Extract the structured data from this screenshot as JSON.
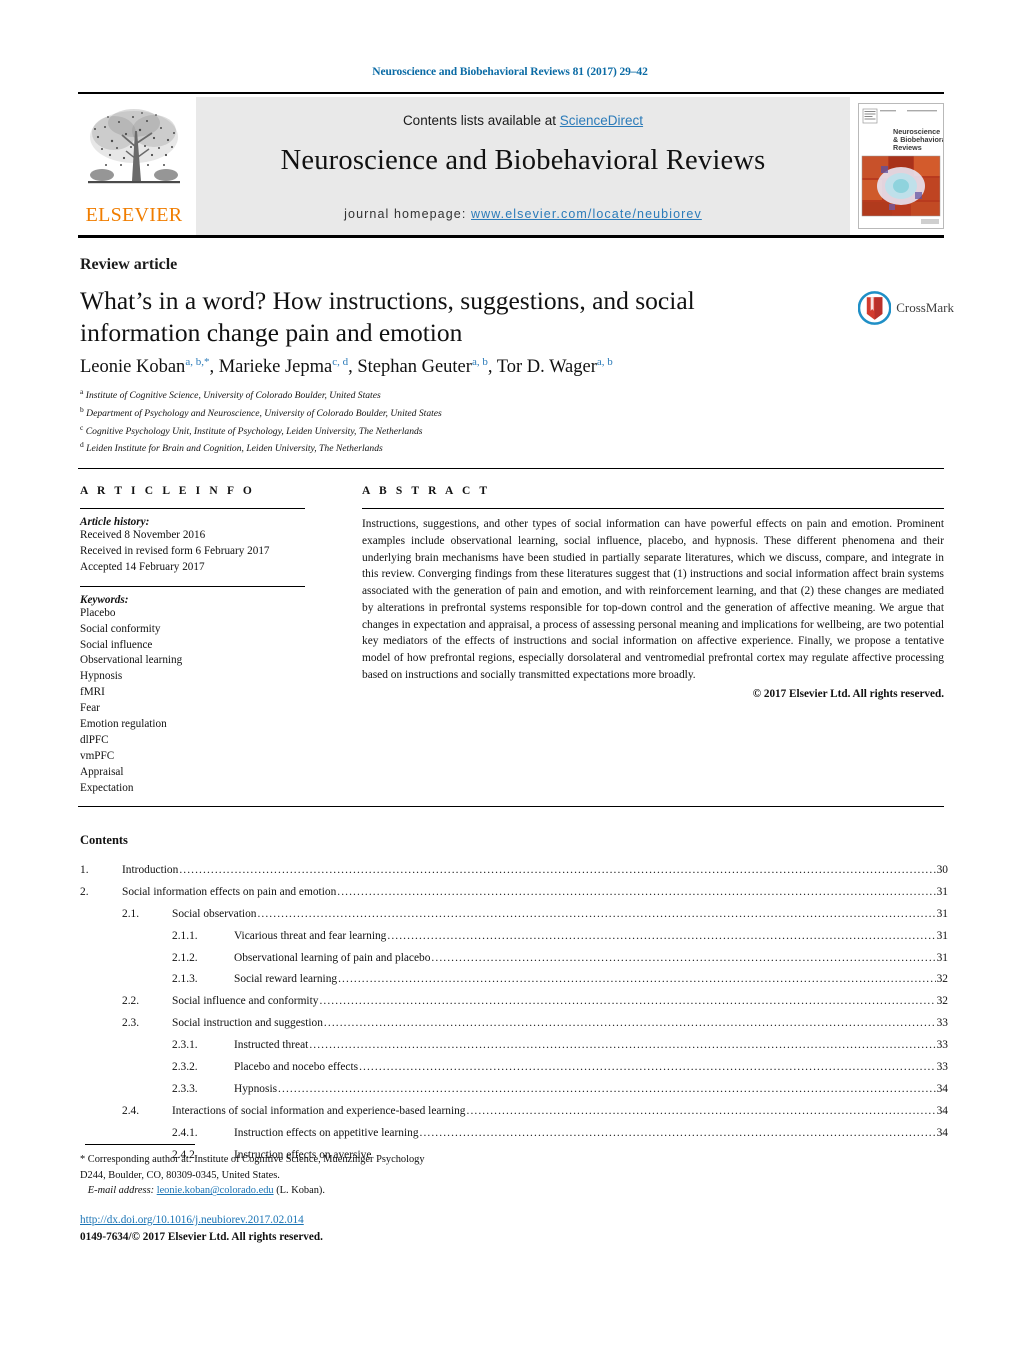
{
  "running_head": "Neuroscience and Biobehavioral Reviews 81 (2017) 29–42",
  "masthead": {
    "contents_prefix": "Contents lists available at ",
    "sciencedirect": "ScienceDirect",
    "journal_title": "Neuroscience and Biobehavioral Reviews",
    "homepage_label": "journal homepage:",
    "homepage_url": "www.elsevier.com/locate/neubiorev",
    "publisher_wordmark": "ELSEVIER",
    "cover_title_line1": "Neuroscience",
    "cover_title_line2": "& Biobehavioral",
    "cover_title_line3": "Reviews"
  },
  "article": {
    "type_label": "Review article",
    "title": "What’s in a word? How instructions, suggestions, and social information change pain and emotion",
    "crossmark_label": "CrossMark",
    "authors": [
      {
        "name": "Leonie Koban",
        "sup": "a, b,",
        "star": "*"
      },
      {
        "name": "Marieke Jepma",
        "sup": "c, d"
      },
      {
        "name": "Stephan Geuter",
        "sup": "a, b"
      },
      {
        "name": "Tor D. Wager",
        "sup": "a, b"
      }
    ],
    "affiliations": [
      {
        "marker": "a",
        "text": "Institute of Cognitive Science, University of Colorado Boulder, United States"
      },
      {
        "marker": "b",
        "text": "Department of Psychology and Neuroscience, University of Colorado Boulder, United States"
      },
      {
        "marker": "c",
        "text": "Cognitive Psychology Unit, Institute of Psychology, Leiden University, The Netherlands"
      },
      {
        "marker": "d",
        "text": "Leiden Institute for Brain and Cognition, Leiden University, The Netherlands"
      }
    ]
  },
  "article_info": {
    "heading": "A R T I C L E   I N F O",
    "history_heading": "Article history:",
    "history": [
      "Received 8 November 2016",
      "Received in revised form 6 February 2017",
      "Accepted 14 February 2017"
    ],
    "keywords_heading": "Keywords:",
    "keywords": [
      "Placebo",
      "Social conformity",
      "Social influence",
      "Observational learning",
      "Hypnosis",
      "fMRI",
      "Fear",
      "Emotion regulation",
      "dlPFC",
      "vmPFC",
      "Appraisal",
      "Expectation"
    ]
  },
  "abstract": {
    "heading": "A B S T R A C T",
    "text": "Instructions, suggestions, and other types of social information can have powerful effects on pain and emotion. Prominent examples include observational learning, social influence, placebo, and hypnosis. These different phenomena and their underlying brain mechanisms have been studied in partially separate literatures, which we discuss, compare, and integrate in this review. Converging findings from these literatures suggest that (1) instructions and social information affect brain systems associated with the generation of pain and emotion, and with reinforcement learning, and that (2) these changes are mediated by alterations in prefrontal systems responsible for top-down control and the generation of affective meaning. We argue that changes in expectation and appraisal, a process of assessing personal meaning and implications for wellbeing, are two potential key mediators of the effects of instructions and social information on affective experience. Finally, we propose a tentative model of how prefrontal regions, especially dorsolateral and ventromedial prefrontal cortex may regulate affective processing based on instructions and socially transmitted expectations more broadly.",
    "copyright": "© 2017 Elsevier Ltd. All rights reserved."
  },
  "contents": {
    "heading": "Contents",
    "entries": [
      {
        "level": 1,
        "num": "1.",
        "label": "Introduction",
        "page": "30"
      },
      {
        "level": 1,
        "num": "2.",
        "label": "Social information effects on pain and emotion",
        "page": "31"
      },
      {
        "level": 2,
        "num": "2.1.",
        "label": "Social observation",
        "page": "31"
      },
      {
        "level": 3,
        "num": "2.1.1.",
        "label": "Vicarious threat and fear learning",
        "page": "31"
      },
      {
        "level": 3,
        "num": "2.1.2.",
        "label": "Observational learning of pain and placebo",
        "page": "31"
      },
      {
        "level": 3,
        "num": "2.1.3.",
        "label": "Social reward learning",
        "page": "32"
      },
      {
        "level": 2,
        "num": "2.2.",
        "label": "Social influence and conformity",
        "page": "32"
      },
      {
        "level": 2,
        "num": "2.3.",
        "label": "Social instruction and suggestion",
        "page": "33"
      },
      {
        "level": 3,
        "num": "2.3.1.",
        "label": "Instructed threat",
        "page": "33"
      },
      {
        "level": 3,
        "num": "2.3.2.",
        "label": "Placebo and nocebo effects",
        "page": "33"
      },
      {
        "level": 3,
        "num": "2.3.3.",
        "label": "Hypnosis",
        "page": "34"
      },
      {
        "level": 2,
        "num": "2.4.",
        "label": "Interactions of social information and experience-based learning",
        "page": "34"
      },
      {
        "level": 3,
        "num": "2.4.1.",
        "label": "Instruction effects on appetitive learning",
        "page": "34"
      },
      {
        "level": 3,
        "num": "2.4.2.",
        "label": "Instruction effects on aversive",
        "page": ""
      }
    ]
  },
  "footer": {
    "corresponding_line1": "* Corresponding author at: Institute of Cognitive Science, Muenzinger Psychology",
    "corresponding_line2": "D244, Boulder, CO, 80309-0345, United States.",
    "email_label": "E-mail address:",
    "email": "leonie.koban@colorado.edu",
    "email_suffix": "(L. Koban).",
    "doi": "http://dx.doi.org/10.1016/j.neubiorev.2017.02.014",
    "issn": "0149-7634/© 2017 Elsevier Ltd. All rights reserved."
  },
  "colors": {
    "link_blue": "#2b7bb9",
    "running_head_blue": "#0b6ba5",
    "elsevier_orange": "#f07d00",
    "band_gray": "#e9e9e9"
  }
}
